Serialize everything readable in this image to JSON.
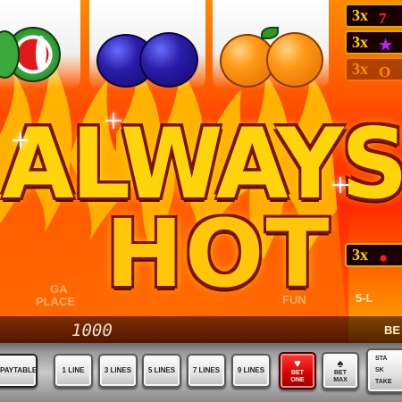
{
  "paytable": {
    "rows": [
      {
        "multiplier": "3x",
        "symbol": "7"
      },
      {
        "multiplier": "3x",
        "symbol": "★"
      },
      {
        "multiplier": "3x",
        "symbol": "O"
      }
    ],
    "bottom_row": {
      "multiplier": "3x",
      "symbol": "●"
    }
  },
  "title": {
    "line1": "ALWAYS",
    "line2": "HOT"
  },
  "background_text": {
    "left": "PLACE",
    "left_top": "GA",
    "right": "FUN",
    "right_far": "5-L",
    "right_bottom": "BE"
  },
  "credit": "1000",
  "buttons": {
    "paytable": "PAYTABLE",
    "line1": "1 LINE",
    "line3": "3 LINES",
    "line5": "5 LINES",
    "line7": "7 LINES",
    "line9": "9 LINES",
    "bet_one": {
      "line1": "BET",
      "line2": "ONE",
      "icon": "♥"
    },
    "bet_max": {
      "line1": "BET",
      "line2": "MAX",
      "icon": "♠"
    },
    "start": {
      "line1": "STA",
      "line2": "SK",
      "line3": "TAKE"
    }
  },
  "colors": {
    "title": "#ffd40a",
    "payrow_border": "#d0b000",
    "fire": "#ff4800"
  }
}
